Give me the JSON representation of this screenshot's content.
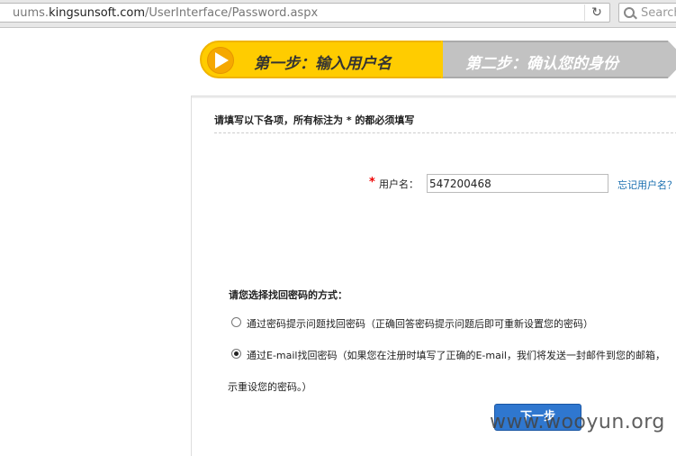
{
  "browser": {
    "url_prefix": "uums.",
    "url_host": "kingsunsoft.com",
    "url_path": "/UserInterface/Password.aspx",
    "search_placeholder": "Search"
  },
  "steps": {
    "step1_label": "第一步：输入用户名",
    "step2_label": "第二步：确认您的身份"
  },
  "form": {
    "instruction": "请填写以下各项，所有标注为 * 的都必须填写",
    "required_mark": "*",
    "username_label": "用户名：",
    "username_value": "547200468",
    "forgot_username_link": "忘记用户名？",
    "method_title": "请您选择找回密码的方式：",
    "option_question": "通过密码提示问题找回密码（正确回答密码提示问题后即可重新设置您的密码）",
    "option_email": "通过E-mail找回密码（如果您在注册时填写了正确的E-mail，我们将发送一封邮件到您的邮箱，",
    "option_email_cont": "示重设您的密码。）",
    "next_button": "下一步",
    "selected_option": "email"
  },
  "watermark": "www.wooyun.org",
  "colors": {
    "active_step": "#ffcc00",
    "inactive_step": "#c2c2c2",
    "link": "#1a6fb0",
    "button": "#2f77cf"
  }
}
